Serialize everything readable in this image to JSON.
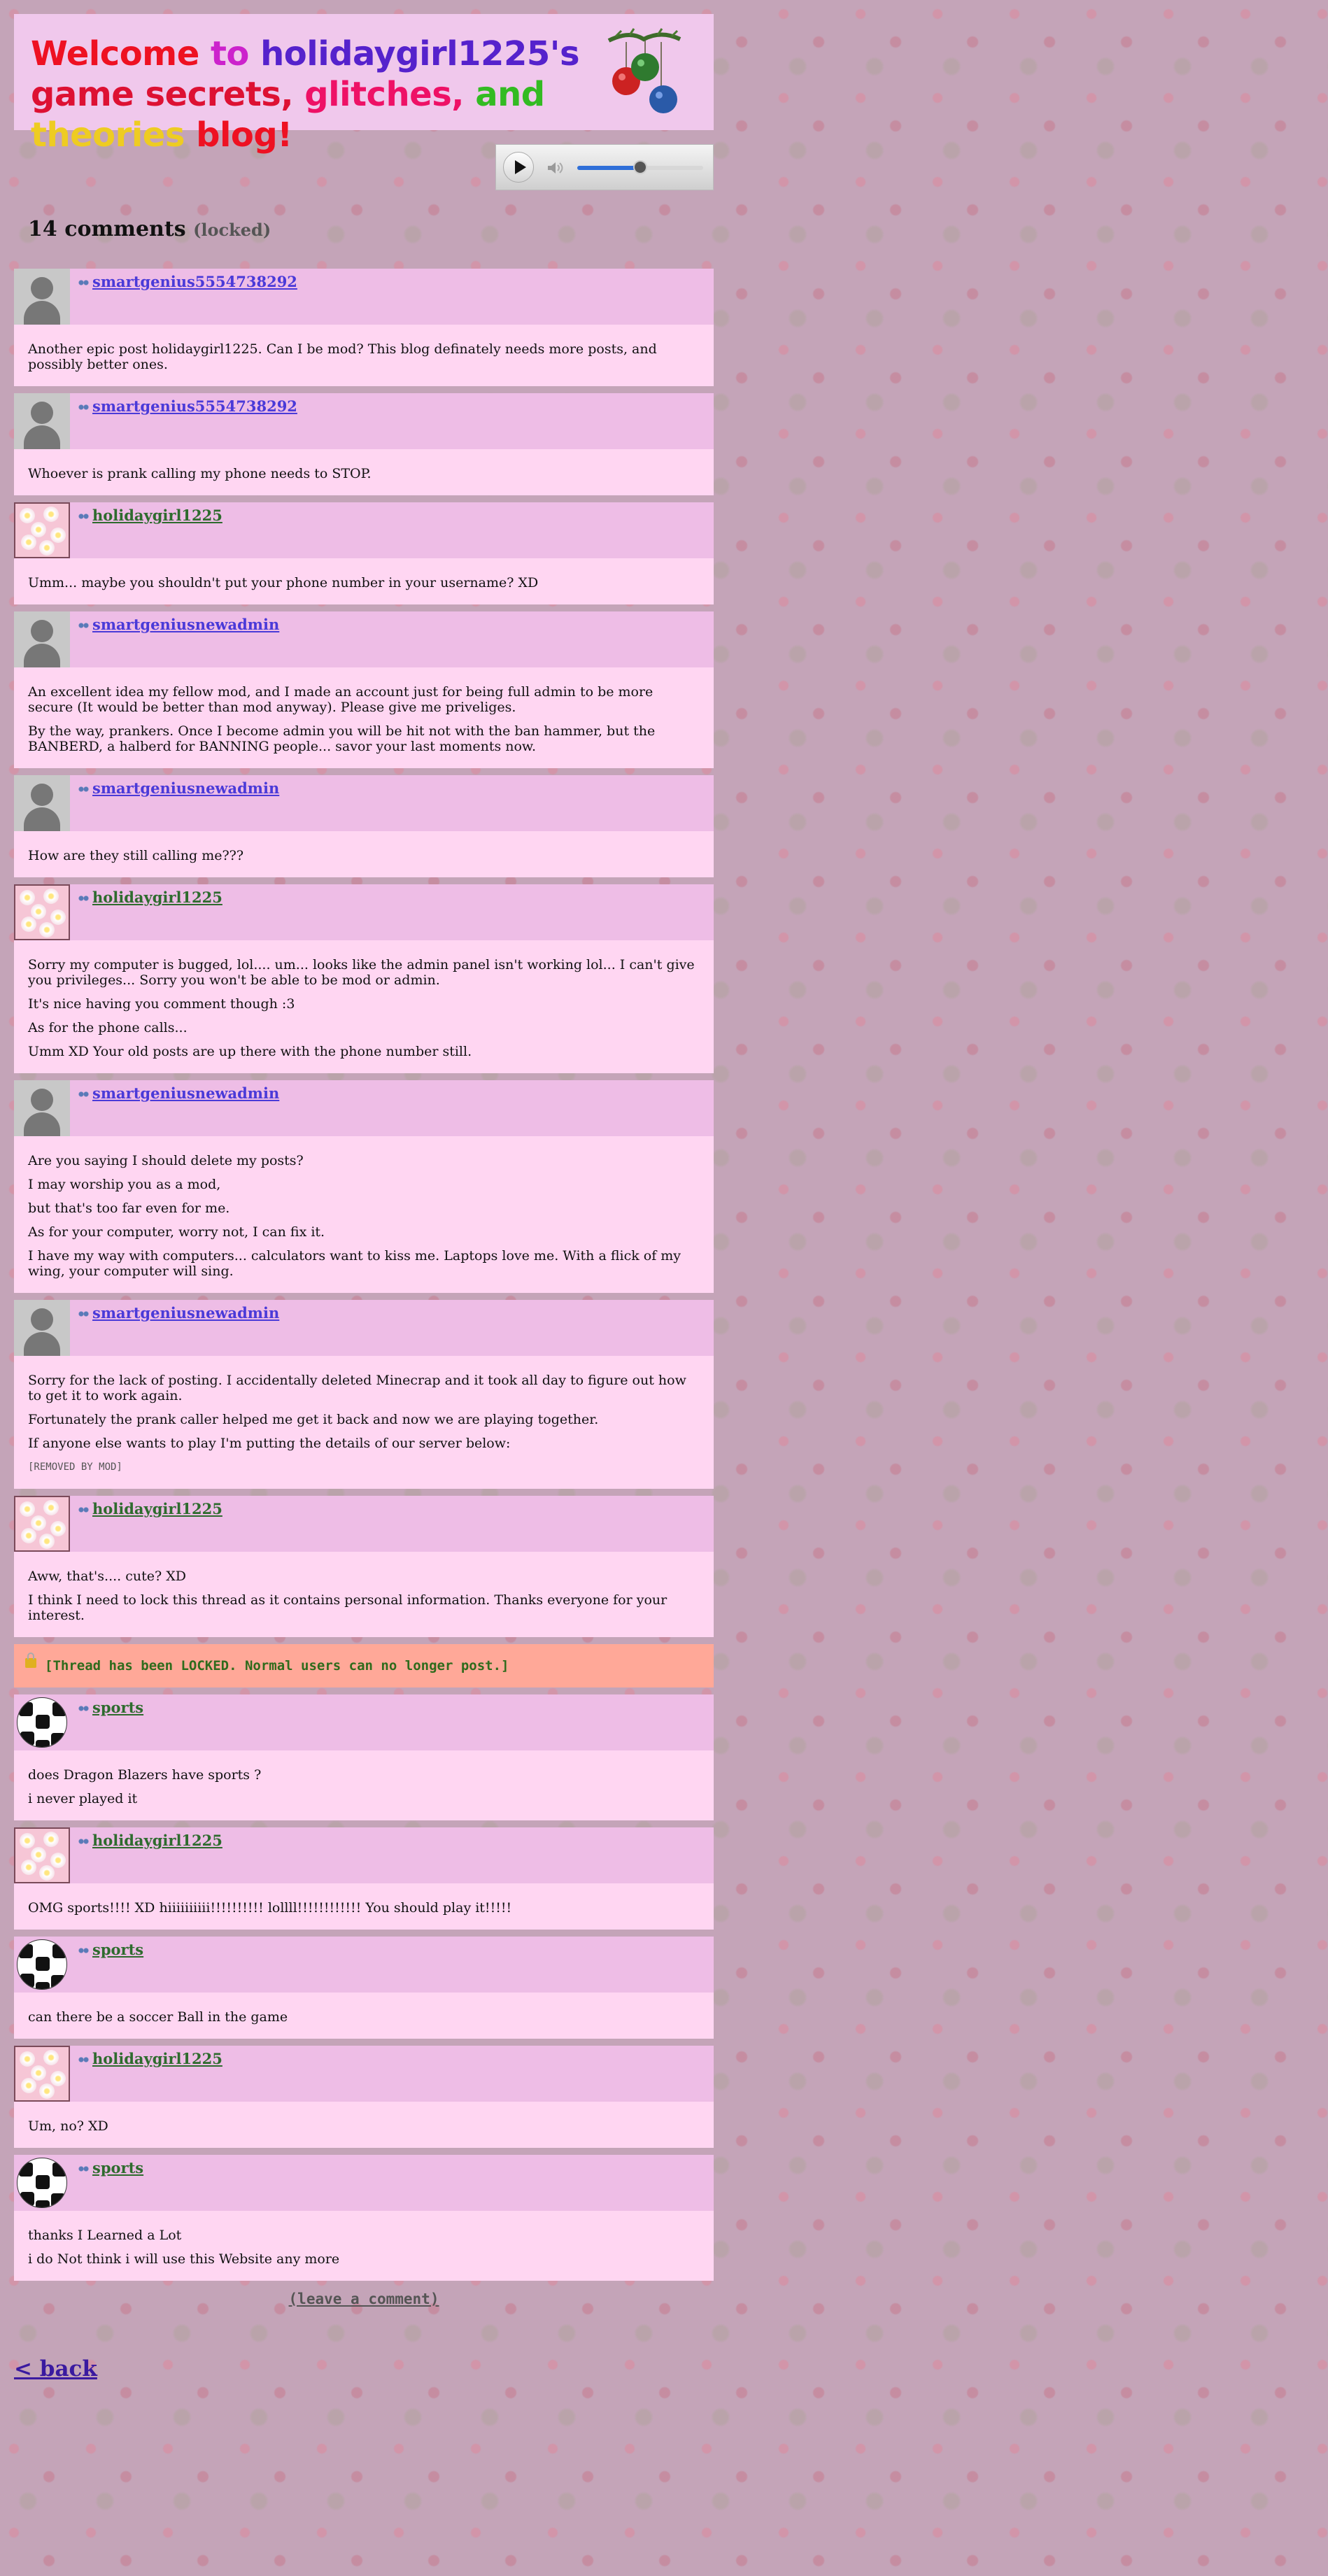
{
  "header": {
    "title_words": [
      {
        "text": "Welcome ",
        "color": "#ee1122"
      },
      {
        "text": "to ",
        "color": "#cc22cc"
      },
      {
        "text": "holidaygirl1225's ",
        "color": "#5522cc"
      },
      {
        "text": "game ",
        "color": "#dd1133"
      },
      {
        "text": "secrets, ",
        "color": "#dd1133"
      },
      {
        "text": "glitches, ",
        "color": "#ee1166"
      },
      {
        "text": "and ",
        "color": "#33bb22"
      },
      {
        "text": "theories ",
        "color": "#eecc22"
      },
      {
        "text": "blog!",
        "color": "#ee1122"
      }
    ],
    "ornament_icon": "christmas-ornaments-icon"
  },
  "player": {
    "play_icon": "play-icon",
    "volume_icon": "volume-icon",
    "volume_level_percent": 50
  },
  "comments_heading": {
    "count_label": "14 comments",
    "locked_label": "(locked)"
  },
  "comments": [
    {
      "user": "smartgenius5554738292",
      "avatar": "default-avatar",
      "color": "blue",
      "paragraphs": [
        "Another epic post holidaygirl1225. Can I be mod? This blog definately needs more posts, and possibly better ones."
      ]
    },
    {
      "user": "smartgenius5554738292",
      "avatar": "default-avatar",
      "color": "blue",
      "paragraphs": [
        "Whoever is prank calling my phone needs to STOP."
      ]
    },
    {
      "user": "holidaygirl1225",
      "avatar": "flower-avatar",
      "color": "green",
      "paragraphs": [
        "Umm... maybe you shouldn't put your phone number in your username? XD"
      ]
    },
    {
      "user": "smartgeniusnewadmin",
      "avatar": "default-avatar",
      "color": "blue",
      "paragraphs": [
        "An excellent idea my fellow mod, and I made an account just for being full admin to be more secure (It would be better than mod anyway). Please give me priveliges.",
        "By the way, prankers. Once I become admin you will be hit not with the ban hammer, but the BANBERD, a halberd for BANNING people... savor your last moments now."
      ]
    },
    {
      "user": "smartgeniusnewadmin",
      "avatar": "default-avatar",
      "color": "blue",
      "paragraphs": [
        "How are they still calling me???"
      ]
    },
    {
      "user": "holidaygirl1225",
      "avatar": "flower-avatar",
      "color": "green",
      "paragraphs": [
        "Sorry my computer is bugged, lol.... um... looks like the admin panel isn't working lol... I can't give you privileges... Sorry you won't be able to be mod or admin.",
        "It's nice having you comment though :3",
        "As for the phone calls...",
        "Umm XD Your old posts are up there with the phone number still."
      ]
    },
    {
      "user": "smartgeniusnewadmin",
      "avatar": "default-avatar",
      "color": "blue",
      "paragraphs": [
        "Are you saying I should delete my posts?",
        "I may worship you as a mod,",
        "but that's too far even for me.",
        "As for your computer, worry not, I can fix it.",
        "I have my way with computers... calculators want to kiss me. Laptops love me. With a flick of my wing, your computer will sing."
      ]
    },
    {
      "user": "smartgeniusnewadmin",
      "avatar": "default-avatar",
      "color": "blue",
      "paragraphs": [
        "Sorry for the lack of posting. I accidentally deleted Minecrap and it took all day to figure out how to get it to work again.",
        "Fortunately the prank caller helped me get it back and now we are playing together.",
        "If anyone else wants to play I'm putting the details of our server below:"
      ],
      "removed_note": "[REMOVED BY MOD]"
    },
    {
      "user": "holidaygirl1225",
      "avatar": "flower-avatar",
      "color": "green",
      "paragraphs": [
        "Aww, that's.... cute? XD",
        "I think I need to lock this thread as it contains personal information. Thanks everyone for your interest."
      ]
    }
  ],
  "lock_notice": {
    "text": "[Thread has been LOCKED. Normal users can no longer post.]",
    "icon": "lock-icon"
  },
  "comments_after": [
    {
      "user": "sports",
      "avatar": "soccer-ball-avatar",
      "color": "green",
      "paragraphs": [
        "does Dragon Blazers have sports ?",
        "i never played it"
      ]
    },
    {
      "user": "holidaygirl1225",
      "avatar": "flower-avatar",
      "color": "green",
      "paragraphs": [
        "OMG sports!!!! XD hiiiiiiiiii!!!!!!!!!! lollll!!!!!!!!!!!! You should play it!!!!!"
      ]
    },
    {
      "user": "sports",
      "avatar": "soccer-ball-avatar",
      "color": "green",
      "paragraphs": [
        "can there be a soccer Ball in the game"
      ]
    },
    {
      "user": "holidaygirl1225",
      "avatar": "flower-avatar",
      "color": "green",
      "paragraphs": [
        "Um, no? XD"
      ]
    },
    {
      "user": "sports",
      "avatar": "soccer-ball-avatar",
      "color": "green",
      "paragraphs": [
        "thanks I Learned a Lot",
        "i do Not think i will use this Website any more"
      ]
    }
  ],
  "leave_comment_label": "(leave a comment)",
  "back_label": "< back"
}
